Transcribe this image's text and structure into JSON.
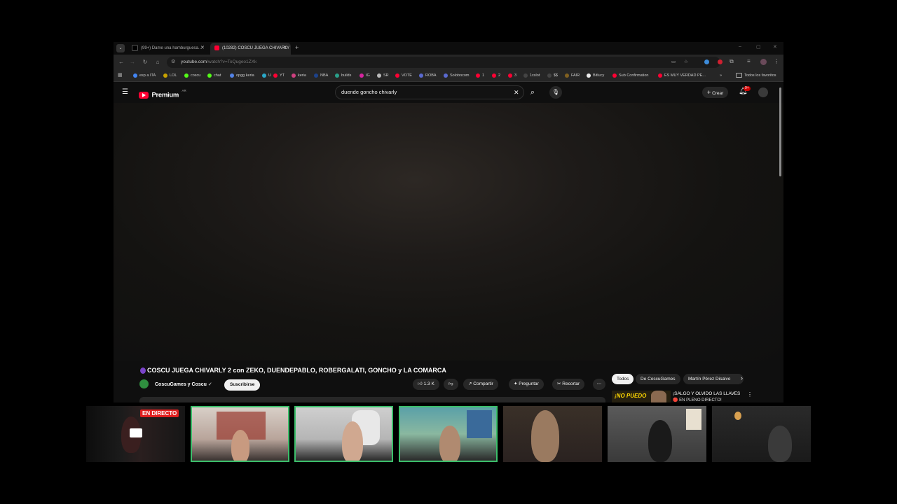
{
  "browser": {
    "tabs": [
      {
        "label": "(99+) Dame una hamburguesa...",
        "active": false
      },
      {
        "label": "(10282) COSCU JUEGA CHIVARLY",
        "active": true
      }
    ],
    "url_host": "youtube.com",
    "url_path": "/watch?v=ToQugeo1ZXk",
    "bookmarks": [
      "esp a ITA",
      "LOL",
      "coscu",
      "chat",
      "opgg keria",
      "U",
      "YT",
      "keria",
      "NBA",
      "builds",
      "IG",
      "SR",
      "VOTE",
      "ROBA",
      "Solobocom",
      "1",
      "2",
      "3",
      "1xslot",
      "$$",
      "FAIR",
      "Bitlucy",
      "Sub Confirmation",
      "ES MUY VERDAD PE..."
    ],
    "bookmarks_overflow": "»",
    "all_bookmarks": "Todos los favoritos"
  },
  "youtube": {
    "logo_text": "Premium",
    "logo_region": "AR",
    "search_value": "duende goncho chivarly",
    "create_label": "Crear",
    "notif_badge": "9+",
    "video_title": "COSCU JUEGA CHIVARLY 2 con ZEKO, DUENDEPABLO, ROBERGALATI, GONCHO y LA COMARCA",
    "channel_name": "CoscuGames y Coscu",
    "subscribe_label": "Suscribirse",
    "likes": "1.3 K",
    "share_label": "Compartir",
    "ask_label": "Preguntar",
    "clip_label": "Recortar",
    "chips": [
      "Todos",
      "De CoscuGames",
      "Martín Pérez Disalvo"
    ],
    "rec_title": "¡SALGO Y OLVIDO LAS LLAVES",
    "rec_sub": "🔴 EN PLENO DIRECTO!",
    "rec_thumb_text": "¡NO PUEDO"
  },
  "stream": {
    "live_badge": "EN DIRECTO"
  },
  "colors": {
    "yt_red": "#ff0033",
    "live_red": "#e02020",
    "cam_highlight": "#3cbf6b"
  }
}
